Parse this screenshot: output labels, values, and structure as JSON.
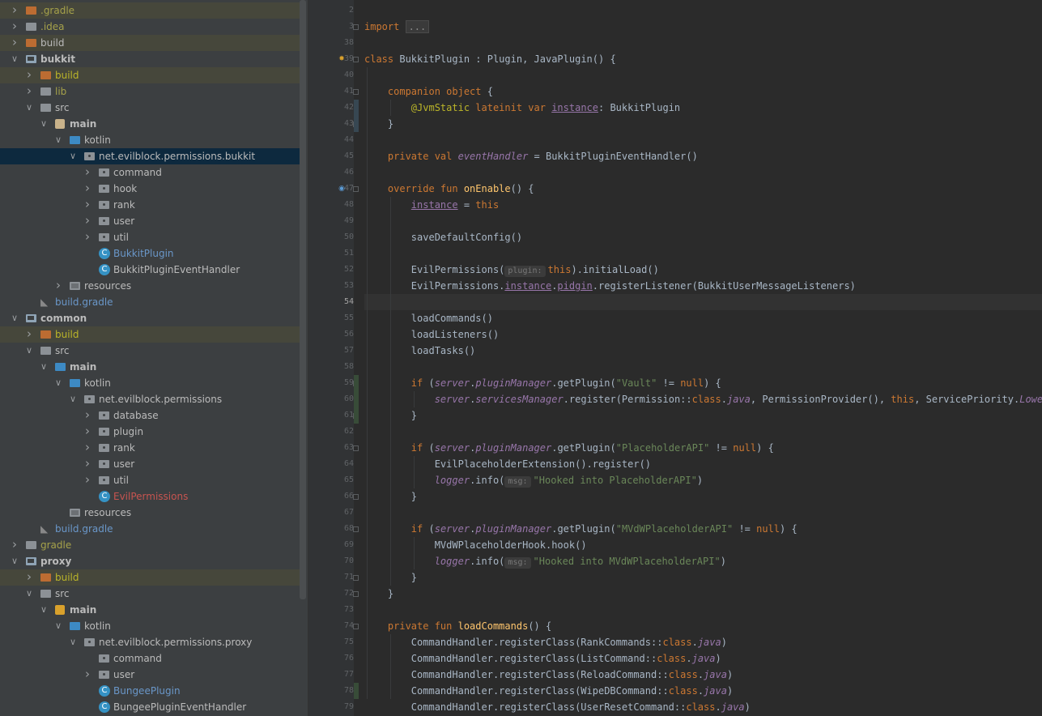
{
  "project_tree": [
    {
      "label": ".gradle",
      "depth": 1,
      "expanded": false,
      "icon": "folder-orange",
      "color": "olive",
      "highlight": true
    },
    {
      "label": ".idea",
      "depth": 1,
      "expanded": false,
      "icon": "folder-gray",
      "color": "olive"
    },
    {
      "label": "build",
      "depth": 1,
      "expanded": false,
      "icon": "folder-orange",
      "highlight": true
    },
    {
      "label": "bukkit",
      "depth": 1,
      "expanded": true,
      "icon": "module-folder",
      "bold": true
    },
    {
      "label": "build",
      "depth": 2,
      "expanded": false,
      "icon": "folder-orange",
      "color": "orange",
      "highlight": true
    },
    {
      "label": "lib",
      "depth": 2,
      "expanded": false,
      "icon": "folder-gray",
      "color": "olive"
    },
    {
      "label": "src",
      "depth": 2,
      "expanded": true,
      "icon": "folder-gray"
    },
    {
      "label": "main",
      "depth": 3,
      "expanded": true,
      "icon": "main-module",
      "bold": true
    },
    {
      "label": "kotlin",
      "depth": 4,
      "expanded": true,
      "icon": "folder-blue"
    },
    {
      "label": "net.evilblock.permissions.bukkit",
      "depth": 5,
      "expanded": true,
      "icon": "package",
      "selected": true
    },
    {
      "label": "command",
      "depth": 6,
      "expanded": false,
      "icon": "package"
    },
    {
      "label": "hook",
      "depth": 6,
      "expanded": false,
      "icon": "package"
    },
    {
      "label": "rank",
      "depth": 6,
      "expanded": false,
      "icon": "package"
    },
    {
      "label": "user",
      "depth": 6,
      "expanded": false,
      "icon": "package"
    },
    {
      "label": "util",
      "depth": 6,
      "expanded": false,
      "icon": "package"
    },
    {
      "label": "BukkitPlugin",
      "depth": 6,
      "icon": "kotlin-class",
      "color": "blue"
    },
    {
      "label": "BukkitPluginEventHandler",
      "depth": 6,
      "icon": "kotlin-class"
    },
    {
      "label": "resources",
      "depth": 4,
      "expanded": false,
      "icon": "resources-folder"
    },
    {
      "label": "build.gradle",
      "depth": 2,
      "icon": "gradle-file",
      "color": "blue"
    },
    {
      "label": "common",
      "depth": 1,
      "expanded": true,
      "icon": "module-folder",
      "bold": true
    },
    {
      "label": "build",
      "depth": 2,
      "expanded": false,
      "icon": "folder-orange",
      "color": "orange",
      "highlight": true
    },
    {
      "label": "src",
      "depth": 2,
      "expanded": true,
      "icon": "folder-gray"
    },
    {
      "label": "main",
      "depth": 3,
      "expanded": true,
      "icon": "folder-blue",
      "bold": true
    },
    {
      "label": "kotlin",
      "depth": 4,
      "expanded": true,
      "icon": "folder-blue"
    },
    {
      "label": "net.evilblock.permissions",
      "depth": 5,
      "expanded": true,
      "icon": "package"
    },
    {
      "label": "database",
      "depth": 6,
      "expanded": false,
      "icon": "package"
    },
    {
      "label": "plugin",
      "depth": 6,
      "expanded": false,
      "icon": "package"
    },
    {
      "label": "rank",
      "depth": 6,
      "expanded": false,
      "icon": "package"
    },
    {
      "label": "user",
      "depth": 6,
      "expanded": false,
      "icon": "package"
    },
    {
      "label": "util",
      "depth": 6,
      "expanded": false,
      "icon": "package"
    },
    {
      "label": "EvilPermissions",
      "depth": 6,
      "icon": "kotlin-class",
      "color": "red"
    },
    {
      "label": "resources",
      "depth": 4,
      "icon": "resources-folder"
    },
    {
      "label": "build.gradle",
      "depth": 2,
      "icon": "gradle-file",
      "color": "blue"
    },
    {
      "label": "gradle",
      "depth": 1,
      "expanded": false,
      "icon": "folder-gray",
      "color": "olive"
    },
    {
      "label": "proxy",
      "depth": 1,
      "expanded": true,
      "icon": "module-folder",
      "bold": true
    },
    {
      "label": "build",
      "depth": 2,
      "expanded": false,
      "icon": "folder-orange",
      "color": "orange",
      "highlight": true
    },
    {
      "label": "src",
      "depth": 2,
      "expanded": true,
      "icon": "folder-gray"
    },
    {
      "label": "main",
      "depth": 3,
      "expanded": true,
      "icon": "main-module-bc",
      "bold": true
    },
    {
      "label": "kotlin",
      "depth": 4,
      "expanded": true,
      "icon": "folder-blue"
    },
    {
      "label": "net.evilblock.permissions.proxy",
      "depth": 5,
      "expanded": true,
      "icon": "package"
    },
    {
      "label": "command",
      "depth": 6,
      "icon": "package"
    },
    {
      "label": "user",
      "depth": 6,
      "expanded": false,
      "icon": "package"
    },
    {
      "label": "BungeePlugin",
      "depth": 6,
      "icon": "kotlin-class",
      "color": "blue"
    },
    {
      "label": "BungeePluginEventHandler",
      "depth": 6,
      "icon": "kotlin-class"
    }
  ],
  "editor": {
    "current_line": "54",
    "lines": [
      {
        "n": "2",
        "indent": 0,
        "t": []
      },
      {
        "n": "3",
        "indent": 0,
        "t": [
          [
            "k",
            "import "
          ],
          [
            "fold",
            "..."
          ]
        ]
      },
      {
        "n": "38",
        "indent": 0,
        "t": []
      },
      {
        "n": "39",
        "indent": 0,
        "t": [
          [
            "k",
            "class "
          ],
          [
            "",
            "BukkitPlugin : Plugin, JavaPlugin() {"
          ]
        ]
      },
      {
        "n": "40",
        "indent": 0,
        "t": []
      },
      {
        "n": "41",
        "indent": 1,
        "t": [
          [
            "k",
            "companion object "
          ],
          [
            "",
            "{"
          ]
        ]
      },
      {
        "n": "42",
        "indent": 2,
        "t": [
          [
            "ann",
            "@JvmStatic "
          ],
          [
            "k",
            "lateinit var "
          ],
          [
            "p",
            "instance"
          ],
          [
            "",
            ": BukkitPlugin"
          ]
        ]
      },
      {
        "n": "43",
        "indent": 1,
        "t": [
          [
            "",
            "}"
          ]
        ]
      },
      {
        "n": "44",
        "indent": 0,
        "t": []
      },
      {
        "n": "45",
        "indent": 1,
        "t": [
          [
            "k",
            "private val "
          ],
          [
            "it",
            "eventHandler"
          ],
          [
            "",
            " = BukkitPluginEventHandler()"
          ]
        ]
      },
      {
        "n": "46",
        "indent": 0,
        "t": []
      },
      {
        "n": "47",
        "indent": 1,
        "t": [
          [
            "k",
            "override fun "
          ],
          [
            "f",
            "onEnable"
          ],
          [
            "",
            "() {"
          ]
        ]
      },
      {
        "n": "48",
        "indent": 2,
        "t": [
          [
            "p",
            "instance"
          ],
          [
            "",
            " = "
          ],
          [
            "k",
            "this"
          ]
        ]
      },
      {
        "n": "49",
        "indent": 0,
        "t": []
      },
      {
        "n": "50",
        "indent": 2,
        "t": [
          [
            "",
            "saveDefaultConfig()"
          ]
        ]
      },
      {
        "n": "51",
        "indent": 0,
        "t": []
      },
      {
        "n": "52",
        "indent": 2,
        "t": [
          [
            "",
            "EvilPermissions("
          ],
          [
            "hint",
            "plugin:"
          ],
          [
            "k",
            "this"
          ],
          [
            "",
            ").initialLoad()"
          ]
        ]
      },
      {
        "n": "53",
        "indent": 2,
        "t": [
          [
            "",
            "EvilPermissions."
          ],
          [
            "p",
            "instance"
          ],
          [
            "",
            "."
          ],
          [
            "p",
            "pidgin"
          ],
          [
            "",
            ".registerListener(BukkitUserMessageListeners)"
          ]
        ]
      },
      {
        "n": "54",
        "indent": 0,
        "t": []
      },
      {
        "n": "55",
        "indent": 2,
        "t": [
          [
            "",
            "loadCommands()"
          ]
        ]
      },
      {
        "n": "56",
        "indent": 2,
        "t": [
          [
            "",
            "loadListeners()"
          ]
        ]
      },
      {
        "n": "57",
        "indent": 2,
        "t": [
          [
            "",
            "loadTasks()"
          ]
        ]
      },
      {
        "n": "58",
        "indent": 0,
        "t": []
      },
      {
        "n": "59",
        "indent": 2,
        "t": [
          [
            "k",
            "if "
          ],
          [
            "",
            "("
          ],
          [
            "it",
            "server"
          ],
          [
            "",
            "."
          ],
          [
            "it",
            "pluginManager"
          ],
          [
            "",
            ".getPlugin("
          ],
          [
            "s",
            "\"Vault\""
          ],
          [
            ")",
            " != "
          ],
          [
            "k",
            "null"
          ],
          [
            "",
            ") {"
          ]
        ]
      },
      {
        "n": "60",
        "indent": 3,
        "t": [
          [
            "it",
            "server"
          ],
          [
            "",
            "."
          ],
          [
            "it",
            "servicesManager"
          ],
          [
            "",
            ".register(Permission::"
          ],
          [
            "k",
            "class"
          ],
          [
            "",
            "."
          ],
          [
            "it",
            "java"
          ],
          [
            "",
            ", PermissionProvider(), "
          ],
          [
            "k",
            "this"
          ],
          [
            "",
            ", ServicePriority."
          ],
          [
            "it",
            "Lowest"
          ],
          [
            "",
            ")"
          ]
        ]
      },
      {
        "n": "61",
        "indent": 2,
        "t": [
          [
            "",
            "}"
          ]
        ]
      },
      {
        "n": "62",
        "indent": 0,
        "t": []
      },
      {
        "n": "63",
        "indent": 2,
        "t": [
          [
            "k",
            "if "
          ],
          [
            "",
            "("
          ],
          [
            "it",
            "server"
          ],
          [
            "",
            "."
          ],
          [
            "it",
            "pluginManager"
          ],
          [
            "",
            ".getPlugin("
          ],
          [
            "s",
            "\"PlaceholderAPI\""
          ],
          [
            "",
            " != "
          ],
          [
            "k",
            "null"
          ],
          [
            "",
            ") {"
          ]
        ]
      },
      {
        "n": "64",
        "indent": 3,
        "t": [
          [
            "",
            "EvilPlaceholderExtension().register()"
          ]
        ]
      },
      {
        "n": "65",
        "indent": 3,
        "t": [
          [
            "it",
            "logger"
          ],
          [
            "",
            ".info("
          ],
          [
            "hint",
            "msg:"
          ],
          [
            "s",
            "\"Hooked into PlaceholderAPI\""
          ],
          [
            "",
            ")"
          ]
        ]
      },
      {
        "n": "66",
        "indent": 2,
        "t": [
          [
            "",
            "}"
          ]
        ]
      },
      {
        "n": "67",
        "indent": 0,
        "t": []
      },
      {
        "n": "68",
        "indent": 2,
        "t": [
          [
            "k",
            "if "
          ],
          [
            "",
            "("
          ],
          [
            "it",
            "server"
          ],
          [
            "",
            "."
          ],
          [
            "it",
            "pluginManager"
          ],
          [
            "",
            ".getPlugin("
          ],
          [
            "s",
            "\"MVdWPlaceholderAPI\""
          ],
          [
            "",
            " != "
          ],
          [
            "k",
            "null"
          ],
          [
            "",
            ") {"
          ]
        ]
      },
      {
        "n": "69",
        "indent": 3,
        "t": [
          [
            "",
            "MVdWPlaceholderHook.hook()"
          ]
        ]
      },
      {
        "n": "70",
        "indent": 3,
        "t": [
          [
            "it",
            "logger"
          ],
          [
            "",
            ".info("
          ],
          [
            "hint",
            "msg:"
          ],
          [
            "s",
            "\"Hooked into MVdWPlaceholderAPI\""
          ],
          [
            "",
            ")"
          ]
        ]
      },
      {
        "n": "71",
        "indent": 2,
        "t": [
          [
            "",
            "}"
          ]
        ]
      },
      {
        "n": "72",
        "indent": 1,
        "t": [
          [
            "",
            "}"
          ]
        ]
      },
      {
        "n": "73",
        "indent": 0,
        "t": []
      },
      {
        "n": "74",
        "indent": 1,
        "t": [
          [
            "k",
            "private fun "
          ],
          [
            "f",
            "loadCommands"
          ],
          [
            "",
            "() {"
          ]
        ]
      },
      {
        "n": "75",
        "indent": 2,
        "t": [
          [
            "",
            "CommandHandler.registerClass(RankCommands::"
          ],
          [
            "k",
            "class"
          ],
          [
            "",
            "."
          ],
          [
            "it",
            "java"
          ],
          [
            "",
            ")"
          ]
        ]
      },
      {
        "n": "76",
        "indent": 2,
        "t": [
          [
            "",
            "CommandHandler.registerClass(ListCommand::"
          ],
          [
            "k",
            "class"
          ],
          [
            "",
            "."
          ],
          [
            "it",
            "java"
          ],
          [
            "",
            ")"
          ]
        ]
      },
      {
        "n": "77",
        "indent": 2,
        "t": [
          [
            "",
            "CommandHandler.registerClass(ReloadCommand::"
          ],
          [
            "k",
            "class"
          ],
          [
            "",
            "."
          ],
          [
            "it",
            "java"
          ],
          [
            "",
            ")"
          ]
        ]
      },
      {
        "n": "78",
        "indent": 2,
        "t": [
          [
            "",
            "CommandHandler.registerClass(WipeDBCommand::"
          ],
          [
            "k",
            "class"
          ],
          [
            "",
            "."
          ],
          [
            "it",
            "java"
          ],
          [
            "",
            ")"
          ]
        ]
      },
      {
        "n": "79",
        "indent": 2,
        "t": [
          [
            "",
            "CommandHandler.registerClass(UserResetCommand::"
          ],
          [
            "k",
            "class"
          ],
          [
            "",
            "."
          ],
          [
            "it",
            "java"
          ],
          [
            "",
            ")"
          ]
        ]
      }
    ]
  }
}
